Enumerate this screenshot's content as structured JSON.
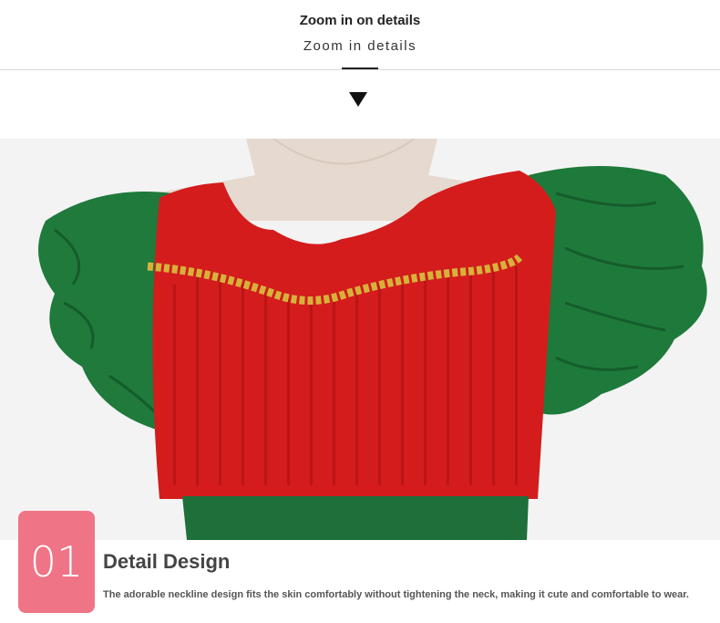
{
  "header": {
    "title": "Zoom in on details",
    "subtitle": "Zoom in details",
    "arrow_icon": "arrow-down-icon"
  },
  "photo": {
    "colors": {
      "background": "#f3f3f3",
      "mannequin": "#e8dcd2",
      "bodice": "#d51e1e",
      "sleeves": "#1e7a3a",
      "trim": "#d6b23a",
      "sash": "#1e6f3a"
    }
  },
  "feature": {
    "number": "01",
    "number_color": "#ef7485",
    "title": "Detail Design",
    "description": "The adorable neckline design fits the skin comfortably without tightening the neck, making it cute and comfortable to wear."
  }
}
